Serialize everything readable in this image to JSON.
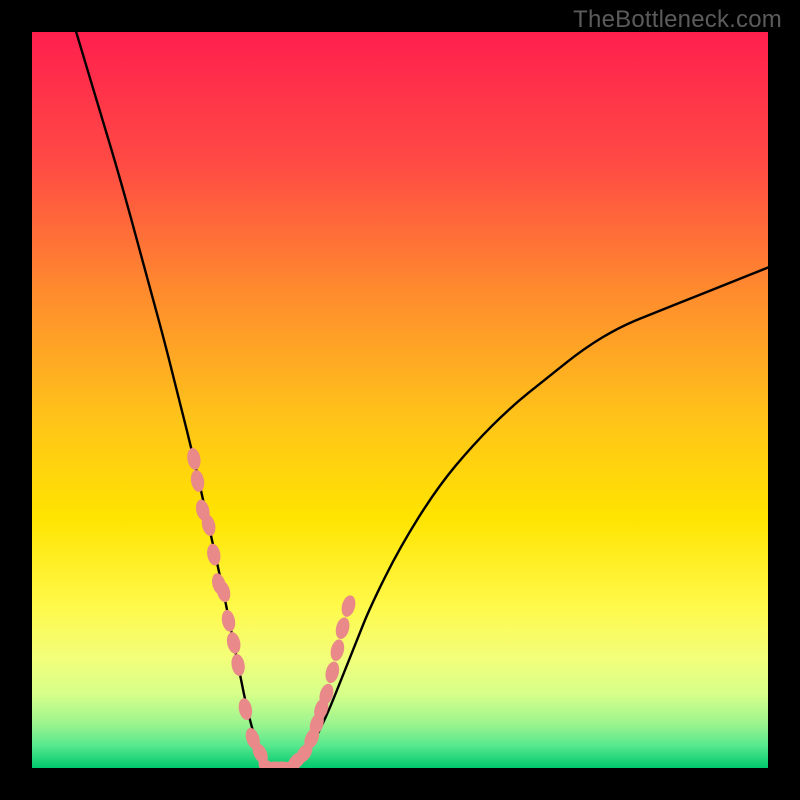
{
  "watermark": {
    "text": "TheBottleneck.com"
  },
  "colors": {
    "black": "#000000",
    "curve": "#000000",
    "marker": "#e98989",
    "grad_top": "#ff1f4e",
    "grad_mid1": "#ff6a3a",
    "grad_mid2": "#ffb21a",
    "grad_mid3": "#ffe400",
    "grad_low1": "#f7ff6e",
    "grad_low2": "#c8ff8e",
    "grad_bottom1": "#56e88e",
    "grad_bottom2": "#00c86d"
  },
  "chart_data": {
    "type": "line",
    "title": "",
    "xlabel": "",
    "ylabel": "",
    "xlim": [
      0,
      100
    ],
    "ylim": [
      0,
      100
    ],
    "grid": false,
    "legend": false,
    "annotations": [
      "TheBottleneck.com"
    ],
    "series": [
      {
        "name": "bottleneck-curve",
        "x": [
          6,
          9,
          12,
          15,
          18,
          20,
          22,
          24,
          26,
          27,
          28,
          29,
          30,
          31,
          32,
          33,
          34,
          36,
          38,
          40,
          42,
          44,
          46,
          50,
          55,
          60,
          65,
          70,
          75,
          80,
          85,
          90,
          95,
          100
        ],
        "y": [
          100,
          90,
          80,
          69,
          58,
          50,
          42,
          33,
          24,
          19,
          14,
          9,
          5,
          2,
          0,
          0,
          0,
          1,
          3,
          7,
          12,
          17,
          22,
          30,
          38,
          44,
          49,
          53,
          57,
          60,
          62,
          64,
          66,
          68
        ]
      }
    ],
    "markers": {
      "name": "highlighted-region",
      "x": [
        22.0,
        22.5,
        23.2,
        24.0,
        24.7,
        25.4,
        26.0,
        26.7,
        27.4,
        28.0,
        29.0,
        30.0,
        31.0,
        32.0,
        33.0,
        34.0,
        35.0,
        36.0,
        37.0,
        38.0,
        38.7,
        39.3,
        40.0,
        40.8,
        41.5,
        42.2,
        43.0
      ],
      "y": [
        42,
        39,
        35,
        33,
        29,
        25,
        24,
        20,
        17,
        14,
        8,
        4,
        2,
        0,
        0,
        0,
        0,
        1,
        2,
        4,
        6,
        8,
        10,
        13,
        16,
        19,
        22
      ]
    },
    "minimum": {
      "x": 33,
      "y": 0
    }
  }
}
